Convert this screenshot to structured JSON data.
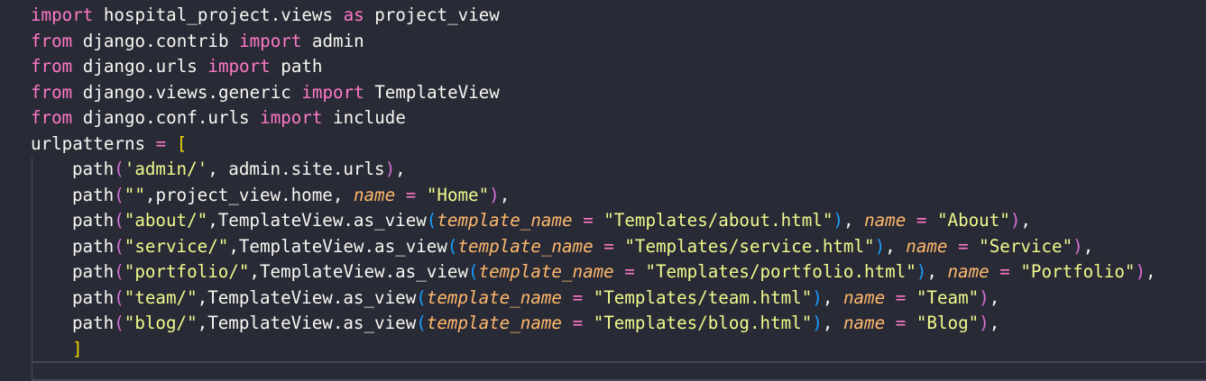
{
  "editor": {
    "language": "python",
    "theme_colors": {
      "background": "#282a36",
      "keyword": "#ff79c6",
      "identifier": "#f8f8f2",
      "string": "#f1fa8c",
      "parameter": "#ffb86c",
      "bracket_level1": "#f1d700",
      "bracket_level2": "#da70d6",
      "bracket_level3": "#179fff"
    },
    "lines": [
      {
        "indent": 0,
        "tokens": [
          {
            "text": "import",
            "type": "kw"
          },
          {
            "text": " hospital_project.views ",
            "type": "id"
          },
          {
            "text": "as",
            "type": "kw"
          },
          {
            "text": " project_view",
            "type": "id"
          }
        ]
      },
      {
        "indent": 0,
        "tokens": [
          {
            "text": "from",
            "type": "kw"
          },
          {
            "text": " django.contrib ",
            "type": "id"
          },
          {
            "text": "import",
            "type": "kw"
          },
          {
            "text": " admin",
            "type": "id"
          }
        ]
      },
      {
        "indent": 0,
        "tokens": [
          {
            "text": "from",
            "type": "kw"
          },
          {
            "text": " django.urls ",
            "type": "id"
          },
          {
            "text": "import",
            "type": "kw"
          },
          {
            "text": " path",
            "type": "id"
          }
        ]
      },
      {
        "indent": 0,
        "tokens": [
          {
            "text": "from",
            "type": "kw"
          },
          {
            "text": " django.views.generic ",
            "type": "id"
          },
          {
            "text": "import",
            "type": "kw"
          },
          {
            "text": " TemplateView",
            "type": "id"
          }
        ]
      },
      {
        "indent": 0,
        "tokens": [
          {
            "text": "from",
            "type": "kw"
          },
          {
            "text": " django.conf.urls ",
            "type": "id"
          },
          {
            "text": "import",
            "type": "kw"
          },
          {
            "text": " include",
            "type": "id"
          }
        ]
      },
      {
        "indent": 0,
        "tokens": [
          {
            "text": "urlpatterns ",
            "type": "id"
          },
          {
            "text": "=",
            "type": "op"
          },
          {
            "text": " ",
            "type": "id"
          },
          {
            "text": "[",
            "type": "p1"
          }
        ]
      },
      {
        "indent": 1,
        "tokens": [
          {
            "text": "path",
            "type": "id"
          },
          {
            "text": "(",
            "type": "p2"
          },
          {
            "text": "'admin/'",
            "type": "str"
          },
          {
            "text": ", admin.site.urls",
            "type": "id"
          },
          {
            "text": ")",
            "type": "p2"
          },
          {
            "text": ",",
            "type": "id"
          }
        ]
      },
      {
        "indent": 1,
        "tokens": [
          {
            "text": "path",
            "type": "id"
          },
          {
            "text": "(",
            "type": "p2"
          },
          {
            "text": "\"\"",
            "type": "str"
          },
          {
            "text": ",project_view.home, ",
            "type": "id"
          },
          {
            "text": "name",
            "type": "param"
          },
          {
            "text": " ",
            "type": "id"
          },
          {
            "text": "=",
            "type": "op"
          },
          {
            "text": " ",
            "type": "id"
          },
          {
            "text": "\"Home\"",
            "type": "str"
          },
          {
            "text": ")",
            "type": "p2"
          },
          {
            "text": ",",
            "type": "id"
          }
        ]
      },
      {
        "indent": 1,
        "tokens": [
          {
            "text": "path",
            "type": "id"
          },
          {
            "text": "(",
            "type": "p2"
          },
          {
            "text": "\"about/\"",
            "type": "str"
          },
          {
            "text": ",TemplateView.as_view",
            "type": "id"
          },
          {
            "text": "(",
            "type": "p3"
          },
          {
            "text": "template_name",
            "type": "param"
          },
          {
            "text": " ",
            "type": "id"
          },
          {
            "text": "=",
            "type": "op"
          },
          {
            "text": " ",
            "type": "id"
          },
          {
            "text": "\"Templates/about.html\"",
            "type": "str"
          },
          {
            "text": ")",
            "type": "p3"
          },
          {
            "text": ", ",
            "type": "id"
          },
          {
            "text": "name",
            "type": "param"
          },
          {
            "text": " ",
            "type": "id"
          },
          {
            "text": "=",
            "type": "op"
          },
          {
            "text": " ",
            "type": "id"
          },
          {
            "text": "\"About\"",
            "type": "str"
          },
          {
            "text": ")",
            "type": "p2"
          },
          {
            "text": ",",
            "type": "id"
          }
        ]
      },
      {
        "indent": 1,
        "tokens": [
          {
            "text": "path",
            "type": "id"
          },
          {
            "text": "(",
            "type": "p2"
          },
          {
            "text": "\"service/\"",
            "type": "str"
          },
          {
            "text": ",TemplateView.as_view",
            "type": "id"
          },
          {
            "text": "(",
            "type": "p3"
          },
          {
            "text": "template_name",
            "type": "param"
          },
          {
            "text": " ",
            "type": "id"
          },
          {
            "text": "=",
            "type": "op"
          },
          {
            "text": " ",
            "type": "id"
          },
          {
            "text": "\"Templates/service.html\"",
            "type": "str"
          },
          {
            "text": ")",
            "type": "p3"
          },
          {
            "text": ", ",
            "type": "id"
          },
          {
            "text": "name",
            "type": "param"
          },
          {
            "text": " ",
            "type": "id"
          },
          {
            "text": "=",
            "type": "op"
          },
          {
            "text": " ",
            "type": "id"
          },
          {
            "text": "\"Service\"",
            "type": "str"
          },
          {
            "text": ")",
            "type": "p2"
          },
          {
            "text": ",",
            "type": "id"
          }
        ]
      },
      {
        "indent": 1,
        "tokens": [
          {
            "text": "path",
            "type": "id"
          },
          {
            "text": "(",
            "type": "p2"
          },
          {
            "text": "\"portfolio/\"",
            "type": "str"
          },
          {
            "text": ",TemplateView.as_view",
            "type": "id"
          },
          {
            "text": "(",
            "type": "p3"
          },
          {
            "text": "template_name",
            "type": "param"
          },
          {
            "text": " ",
            "type": "id"
          },
          {
            "text": "=",
            "type": "op"
          },
          {
            "text": " ",
            "type": "id"
          },
          {
            "text": "\"Templates/portfolio.html\"",
            "type": "str"
          },
          {
            "text": ")",
            "type": "p3"
          },
          {
            "text": ", ",
            "type": "id"
          },
          {
            "text": "name",
            "type": "param"
          },
          {
            "text": " ",
            "type": "id"
          },
          {
            "text": "=",
            "type": "op"
          },
          {
            "text": " ",
            "type": "id"
          },
          {
            "text": "\"Portfolio\"",
            "type": "str"
          },
          {
            "text": ")",
            "type": "p2"
          },
          {
            "text": ",",
            "type": "id"
          }
        ]
      },
      {
        "indent": 1,
        "tokens": [
          {
            "text": "path",
            "type": "id"
          },
          {
            "text": "(",
            "type": "p2"
          },
          {
            "text": "\"team/\"",
            "type": "str"
          },
          {
            "text": ",TemplateView.as_view",
            "type": "id"
          },
          {
            "text": "(",
            "type": "p3"
          },
          {
            "text": "template_name",
            "type": "param"
          },
          {
            "text": " ",
            "type": "id"
          },
          {
            "text": "=",
            "type": "op"
          },
          {
            "text": " ",
            "type": "id"
          },
          {
            "text": "\"Templates/team.html\"",
            "type": "str"
          },
          {
            "text": ")",
            "type": "p3"
          },
          {
            "text": ", ",
            "type": "id"
          },
          {
            "text": "name",
            "type": "param"
          },
          {
            "text": " ",
            "type": "id"
          },
          {
            "text": "=",
            "type": "op"
          },
          {
            "text": " ",
            "type": "id"
          },
          {
            "text": "\"Team\"",
            "type": "str"
          },
          {
            "text": ")",
            "type": "p2"
          },
          {
            "text": ",",
            "type": "id"
          }
        ]
      },
      {
        "indent": 1,
        "tokens": [
          {
            "text": "path",
            "type": "id"
          },
          {
            "text": "(",
            "type": "p2"
          },
          {
            "text": "\"blog/\"",
            "type": "str"
          },
          {
            "text": ",TemplateView.as_view",
            "type": "id"
          },
          {
            "text": "(",
            "type": "p3"
          },
          {
            "text": "template_name",
            "type": "param"
          },
          {
            "text": " ",
            "type": "id"
          },
          {
            "text": "=",
            "type": "op"
          },
          {
            "text": " ",
            "type": "id"
          },
          {
            "text": "\"Templates/blog.html\"",
            "type": "str"
          },
          {
            "text": ")",
            "type": "p3"
          },
          {
            "text": ", ",
            "type": "id"
          },
          {
            "text": "name",
            "type": "param"
          },
          {
            "text": " ",
            "type": "id"
          },
          {
            "text": "=",
            "type": "op"
          },
          {
            "text": " ",
            "type": "id"
          },
          {
            "text": "\"Blog\"",
            "type": "str"
          },
          {
            "text": ")",
            "type": "p2"
          },
          {
            "text": ",",
            "type": "id"
          }
        ]
      },
      {
        "indent": 1,
        "tokens": [
          {
            "text": "]",
            "type": "p1"
          }
        ]
      }
    ]
  }
}
